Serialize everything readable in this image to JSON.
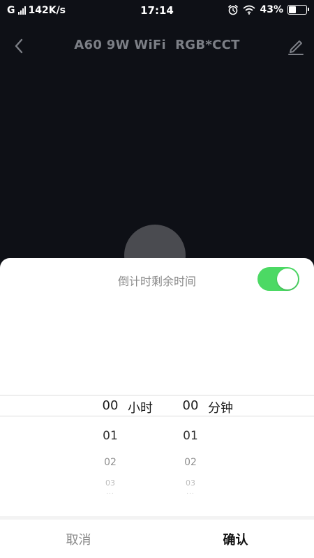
{
  "status_bar": {
    "carrier": "G",
    "network_speed": "142K/s",
    "time": "17:14",
    "battery_percent": "43%",
    "battery_level": 0.43,
    "icons": [
      "signal-icon",
      "alarm-icon",
      "wifi-icon",
      "battery-icon"
    ]
  },
  "header": {
    "title": "A60 9W WiFi  RGB*CCT",
    "icons": [
      "back-arrow-icon",
      "edit-pencil-icon"
    ]
  },
  "sheet": {
    "title": "倒计时剩余时间",
    "toggle_on": true,
    "toggle_color": "#4cd964"
  },
  "picker": {
    "hours": [
      "00",
      "01",
      "02",
      "03",
      "..."
    ],
    "hour_unit": "小时",
    "minutes": [
      "00",
      "01",
      "02",
      "03",
      "..."
    ],
    "minute_unit": "分钟"
  },
  "footer": {
    "cancel_label": "取消",
    "confirm_label": "确认"
  }
}
